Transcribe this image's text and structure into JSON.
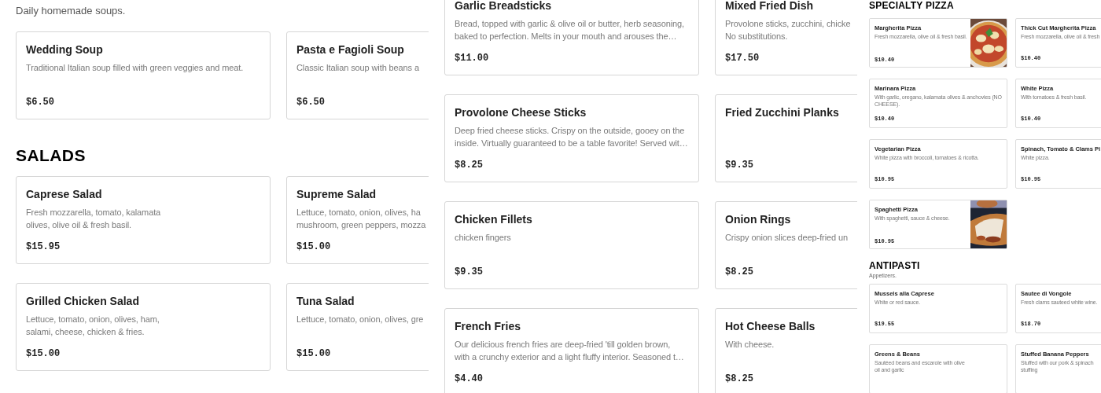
{
  "panels": [
    {
      "kind": "regular",
      "sections": [
        {
          "description": "Daily homemade soups.",
          "items": [
            {
              "name": "Wedding Soup",
              "description_lines": [
                "Traditional Italian soup filled with green veggies and meat."
              ],
              "price": "$6.50"
            },
            {
              "name": "Pasta e Fagioli Soup",
              "description_lines": [
                "Classic Italian soup with beans a"
              ],
              "price": "$6.50"
            }
          ]
        },
        {
          "title": "SALADS",
          "items": [
            {
              "name": "Caprese Salad",
              "description_lines": [
                "Fresh mozzarella, tomato, kalamata",
                "olives, olive oil & fresh basil."
              ],
              "price": "$15.95"
            },
            {
              "name": "Supreme Salad",
              "description_lines": [
                "Lettuce, tomato, onion, olives, ha",
                "mushroom, green peppers, mozza"
              ],
              "price": "$15.00"
            },
            {
              "name": "Grilled Chicken Salad",
              "description_lines": [
                "Lettuce, tomato, onion, olives, ham,",
                "salami, cheese, chicken & fries."
              ],
              "price": "$15.00"
            },
            {
              "name": "Tuna Salad",
              "description_lines": [
                "Lettuce, tomato, onion, olives, gre"
              ],
              "price": "$15.00"
            }
          ]
        }
      ]
    },
    {
      "kind": "regular",
      "sections": [
        {
          "items": [
            {
              "name": "Garlic Breadsticks",
              "description_lines": [
                "Bread, topped with garlic & olive oil or butter, herb seasoning,",
                "baked to perfection. Melts in your mouth and arouses the…"
              ],
              "price": "$11.00"
            },
            {
              "name": "Mixed Fried Dish",
              "description_lines": [
                "Provolone sticks, zucchini, chicke",
                "No substitutions."
              ],
              "price": "$17.50"
            },
            {
              "name": "Provolone Cheese Sticks",
              "description_lines": [
                "Deep fried cheese sticks. Crispy on the outside, gooey on the",
                "inside. Virtually guaranteed to be a table favorite! Served wit…"
              ],
              "price": "$8.25"
            },
            {
              "name": "Fried Zucchini Planks",
              "price": "$9.35"
            },
            {
              "name": "Chicken Fillets",
              "description_lines": [
                "chicken fingers"
              ],
              "price": "$9.35"
            },
            {
              "name": "Onion Rings",
              "description_lines": [
                "Crispy onion slices deep-fried un"
              ],
              "price": "$8.25"
            },
            {
              "name": "French Fries",
              "description_lines": [
                "Our delicious french fries are deep-fried 'till golden brown,",
                "with a crunchy exterior and a light fluffy interior. Seasoned t…"
              ],
              "price": "$4.40"
            },
            {
              "name": "Hot Cheese Balls",
              "description_lines": [
                "With cheese."
              ],
              "price": "$8.25"
            }
          ]
        }
      ]
    },
    {
      "kind": "compact",
      "sections": [
        {
          "title": "SPECIALTY PIZZA",
          "items": [
            {
              "name": "Margherita Pizza",
              "description_lines": [
                "Fresh mozzarella, olive oil & fresh basil."
              ],
              "price": "$10.40",
              "image": {
                "kind": "picture"
              }
            },
            {
              "name": "Thick Cut Margherita Pizza",
              "description_lines": [
                "Fresh mozzarella, olive oil & fresh"
              ],
              "price": "$10.40"
            },
            {
              "name": "Marinara Pizza",
              "description_lines": [
                "With garlic, oregano, kalamata olives & anchovies (NO",
                "CHEESE)."
              ],
              "price": "$10.40"
            },
            {
              "name": "White Pizza",
              "description_lines": [
                "With tomatoes & fresh basil."
              ],
              "price": "$10.40"
            },
            {
              "name": "Vegetarian Pizza",
              "description_lines": [
                "White pizza with broccoli, tomatoes & ricotta."
              ],
              "price": "$10.95"
            },
            {
              "name": "Spinach, Tomato & Clams Pi",
              "description_lines": [
                "White pizza."
              ],
              "price": "$10.95"
            },
            {
              "name": "Spaghetti Pizza",
              "description_lines": [
                "With spaghetti, sauce & cheese."
              ],
              "price": "$10.95",
              "image": {
                "kind": "picture"
              }
            }
          ]
        },
        {
          "title": "ANTIPASTI",
          "description": "Appetizers.",
          "items": [
            {
              "name": "Mussels alla Caprese",
              "description_lines": [
                "White or red sauce."
              ],
              "price": "$19.55"
            },
            {
              "name": "Sautee di Vongole",
              "description_lines": [
                "Fresh clams sauteed white wine."
              ],
              "price": "$18.70"
            },
            {
              "name": "Greens & Beans",
              "description_lines": [
                "Sautéed beans and escarole with olive",
                "oil and garlic"
              ]
            },
            {
              "name": "Stuffed Banana Peppers",
              "description_lines": [
                "Stuffed with our pork & spinach",
                "stuffing"
              ]
            }
          ]
        }
      ]
    }
  ]
}
